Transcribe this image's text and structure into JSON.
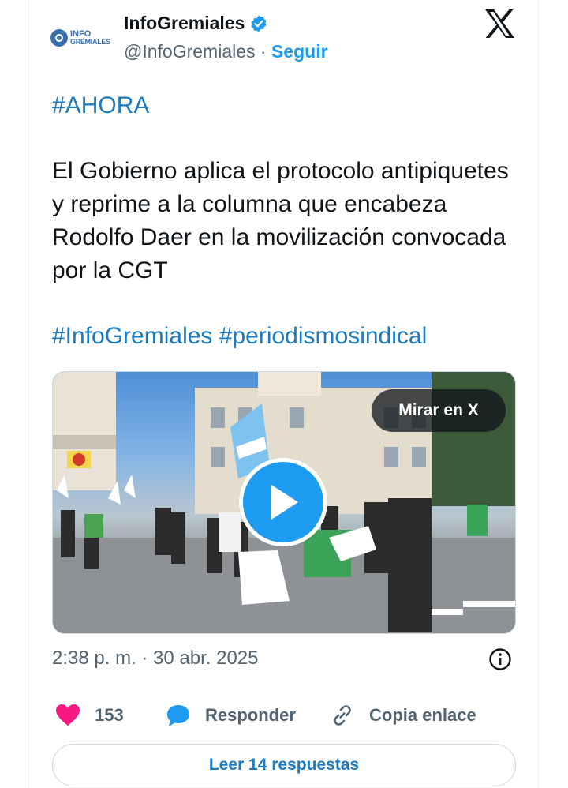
{
  "author": {
    "display_name": "InfoGremiales",
    "handle": "@InfoGremiales",
    "separator": "·",
    "follow_label": "Seguir",
    "avatar_text_line1": "INFO",
    "avatar_text_line2": "GREMIALES",
    "verified": true
  },
  "tweet": {
    "hashtag_line": "#AHORA",
    "body": "El Gobierno aplica el protocolo antipiquetes y reprime a la columna que encabeza Rodolfo Daer en la movilización convocada por la CGT",
    "hashtag_1": "#InfoGremiales",
    "hashtag_2": "#periodismosindical",
    "timestamp": "2:38 p. m. · 30 abr. 2025"
  },
  "media": {
    "watch_label": "Mirar en X",
    "type": "video"
  },
  "actions": {
    "likes": "153",
    "reply_label": "Responder",
    "copy_label": "Copia enlace"
  },
  "footer": {
    "read_replies_label": "Leer 14 respuestas"
  },
  "colors": {
    "accent": "#1d9bf0",
    "link": "#1d7bc2",
    "like": "#f91880",
    "muted": "#536471"
  }
}
